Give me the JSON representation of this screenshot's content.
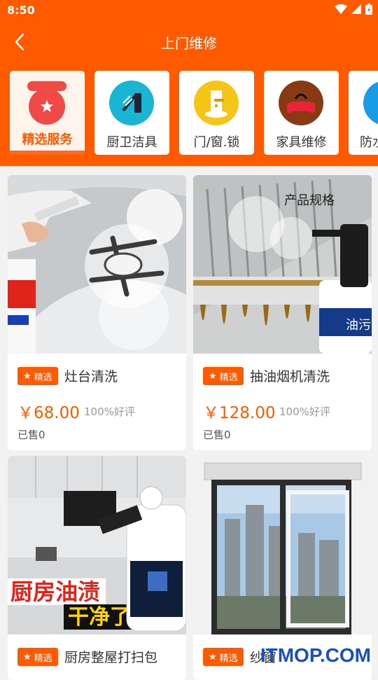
{
  "status_bar": {
    "time": "8:50"
  },
  "nav": {
    "title": "上门维修"
  },
  "categories": [
    {
      "label": "精选服务",
      "icon": "badge-star-icon",
      "active": true,
      "color": "#ef4a45"
    },
    {
      "label": "厨卫洁具",
      "icon": "shower-icon",
      "active": false,
      "color": "#1ab4d4"
    },
    {
      "label": "门/窗.锁",
      "icon": "door-lock-icon",
      "active": false,
      "color": "#f5c518"
    },
    {
      "label": "家具维修",
      "icon": "sofa-icon",
      "active": false,
      "color": "#8a3a12"
    },
    {
      "label": "防水",
      "icon": "waterproof-icon",
      "active": false,
      "color": "#1a9be6"
    }
  ],
  "products": [
    {
      "badge": "精选",
      "title": "灶台清洗",
      "price": "￥68.00",
      "rating": "100%好评",
      "sold": "已售0",
      "image": "stove-cleaning-photo"
    },
    {
      "badge": "精选",
      "title": "抽油烟机清洗",
      "price": "￥128.00",
      "rating": "100%好评",
      "sold": "已售0",
      "image": "range-hood-cleaning-photo",
      "image_text": [
        "产品规格",
        "油污"
      ]
    },
    {
      "badge": "精选",
      "title": "厨房整屋打扫包",
      "image": "kitchen-cleaning-photo",
      "image_text": [
        "厨房油渍",
        "干净了"
      ]
    },
    {
      "badge": "精选",
      "title": "纱窗",
      "image": "window-screen-photo"
    }
  ],
  "watermark": "ITMOP.COM",
  "colors": {
    "accent": "#ff5a00",
    "background": "#f2f2f2"
  }
}
